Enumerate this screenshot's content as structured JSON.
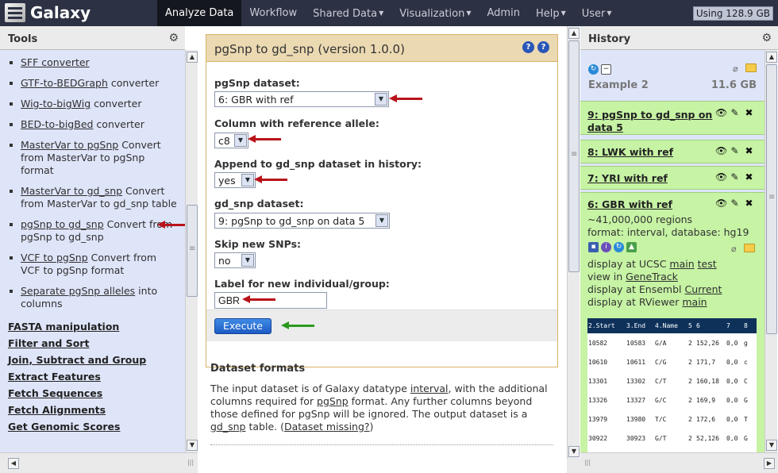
{
  "masthead": {
    "brand": "Galaxy",
    "nav": [
      {
        "label": "Analyze Data",
        "active": true,
        "dropdown": false
      },
      {
        "label": "Workflow",
        "active": false,
        "dropdown": false
      },
      {
        "label": "Shared Data",
        "active": false,
        "dropdown": true
      },
      {
        "label": "Visualization",
        "active": false,
        "dropdown": true
      },
      {
        "label": "Admin",
        "active": false,
        "dropdown": false
      },
      {
        "label": "Help",
        "active": false,
        "dropdown": true
      },
      {
        "label": "User",
        "active": false,
        "dropdown": true
      }
    ],
    "usage": "Using 128.9 GB"
  },
  "tools_panel": {
    "title": "Tools",
    "items": [
      {
        "link": "SFF converter",
        "rest": ""
      },
      {
        "link": "GTF-to-BEDGraph",
        "rest": " converter"
      },
      {
        "link": "Wig-to-bigWig",
        "rest": " converter"
      },
      {
        "link": "BED-to-bigBed",
        "rest": " converter"
      },
      {
        "link": "MasterVar to pgSnp",
        "rest": " Convert from MasterVar to pgSnp format"
      },
      {
        "link": "MasterVar to gd_snp",
        "rest": " Convert from MasterVar to gd_snp table"
      },
      {
        "link": "pgSnp to gd_snp",
        "rest": " Convert from pgSnp to gd_snp"
      },
      {
        "link": "VCF to pgSnp",
        "rest": " Convert from VCF to pgSnp format"
      },
      {
        "link": "Separate pgSnp alleles",
        "rest": " into columns"
      }
    ],
    "sections": [
      "FASTA manipulation",
      "Filter and Sort",
      "Join, Subtract and Group",
      "Extract Features",
      "Fetch Sequences",
      "Fetch Alignments",
      "Get Genomic Scores"
    ]
  },
  "tool_form": {
    "title": "pgSnp to gd_snp (version 1.0.0)",
    "help_icons": [
      "?",
      "?"
    ],
    "fields": [
      {
        "label": "pgSnp dataset:",
        "value": "6: GBR with ref"
      },
      {
        "label": "Column with reference allele:",
        "value": "c8"
      },
      {
        "label": "Append to gd_snp dataset in history:",
        "value": "yes"
      },
      {
        "label": "gd_snp dataset:",
        "value": "9: pgSnp to gd_snp on data 5"
      },
      {
        "label": "Skip new SNPs:",
        "value": "no"
      },
      {
        "label": "Label for new individual/group:",
        "value": "GBR"
      }
    ],
    "execute_label": "Execute",
    "formats": {
      "heading": "Dataset formats",
      "p1": "The input dataset is of Galaxy datatype ",
      "l1": "interval",
      "p2": ", with the additional columns required for ",
      "l2": "pgSnp",
      "p3": " format. Any further columns beyond those defined for pgSnp will be ignored. The output dataset is a ",
      "l3": "gd_snp",
      "p4": " table. (",
      "l4": "Dataset missing?",
      "p5": ")"
    }
  },
  "history": {
    "title": "History",
    "name": "Example 2",
    "size": "11.6 GB",
    "datasets": [
      {
        "title": "9: pgSnp to gd_snp on data 5"
      },
      {
        "title": "8: LWK with ref"
      },
      {
        "title": "7: YRI with ref"
      },
      {
        "title": "6: GBR with ref"
      }
    ],
    "expanded": {
      "regions": "~41,000,000 regions",
      "format": "format: interval, database: hg19",
      "links": [
        {
          "pre": "display at UCSC ",
          "a": "main",
          "mid": " ",
          "b": "test"
        },
        {
          "pre": "view in ",
          "a": "GeneTrack",
          "mid": "",
          "b": ""
        },
        {
          "pre": "display at Ensembl ",
          "a": "Current",
          "mid": "",
          "b": ""
        },
        {
          "pre": "display at RViewer ",
          "a": "main",
          "mid": "",
          "b": ""
        }
      ],
      "peek_header": [
        "2.Start",
        "3.End",
        "4.Name",
        "5",
        "6",
        "7",
        "8"
      ],
      "peek_rows": [
        [
          "10582",
          "10583",
          "G/A",
          "2",
          "152,26",
          "0,0",
          "g"
        ],
        [
          "10610",
          "10611",
          "C/G",
          "2",
          "171,7",
          "0,0",
          "c"
        ],
        [
          "13301",
          "13302",
          "C/T",
          "2",
          "160,18",
          "0,0",
          "C"
        ],
        [
          "13326",
          "13327",
          "G/C",
          "2",
          "169,9",
          "0,0",
          "G"
        ],
        [
          "13979",
          "13980",
          "T/C",
          "2",
          "172,6",
          "0,0",
          "T"
        ],
        [
          "30922",
          "30923",
          "G/T",
          "2",
          "52,126",
          "0,0",
          "G"
        ]
      ]
    }
  }
}
